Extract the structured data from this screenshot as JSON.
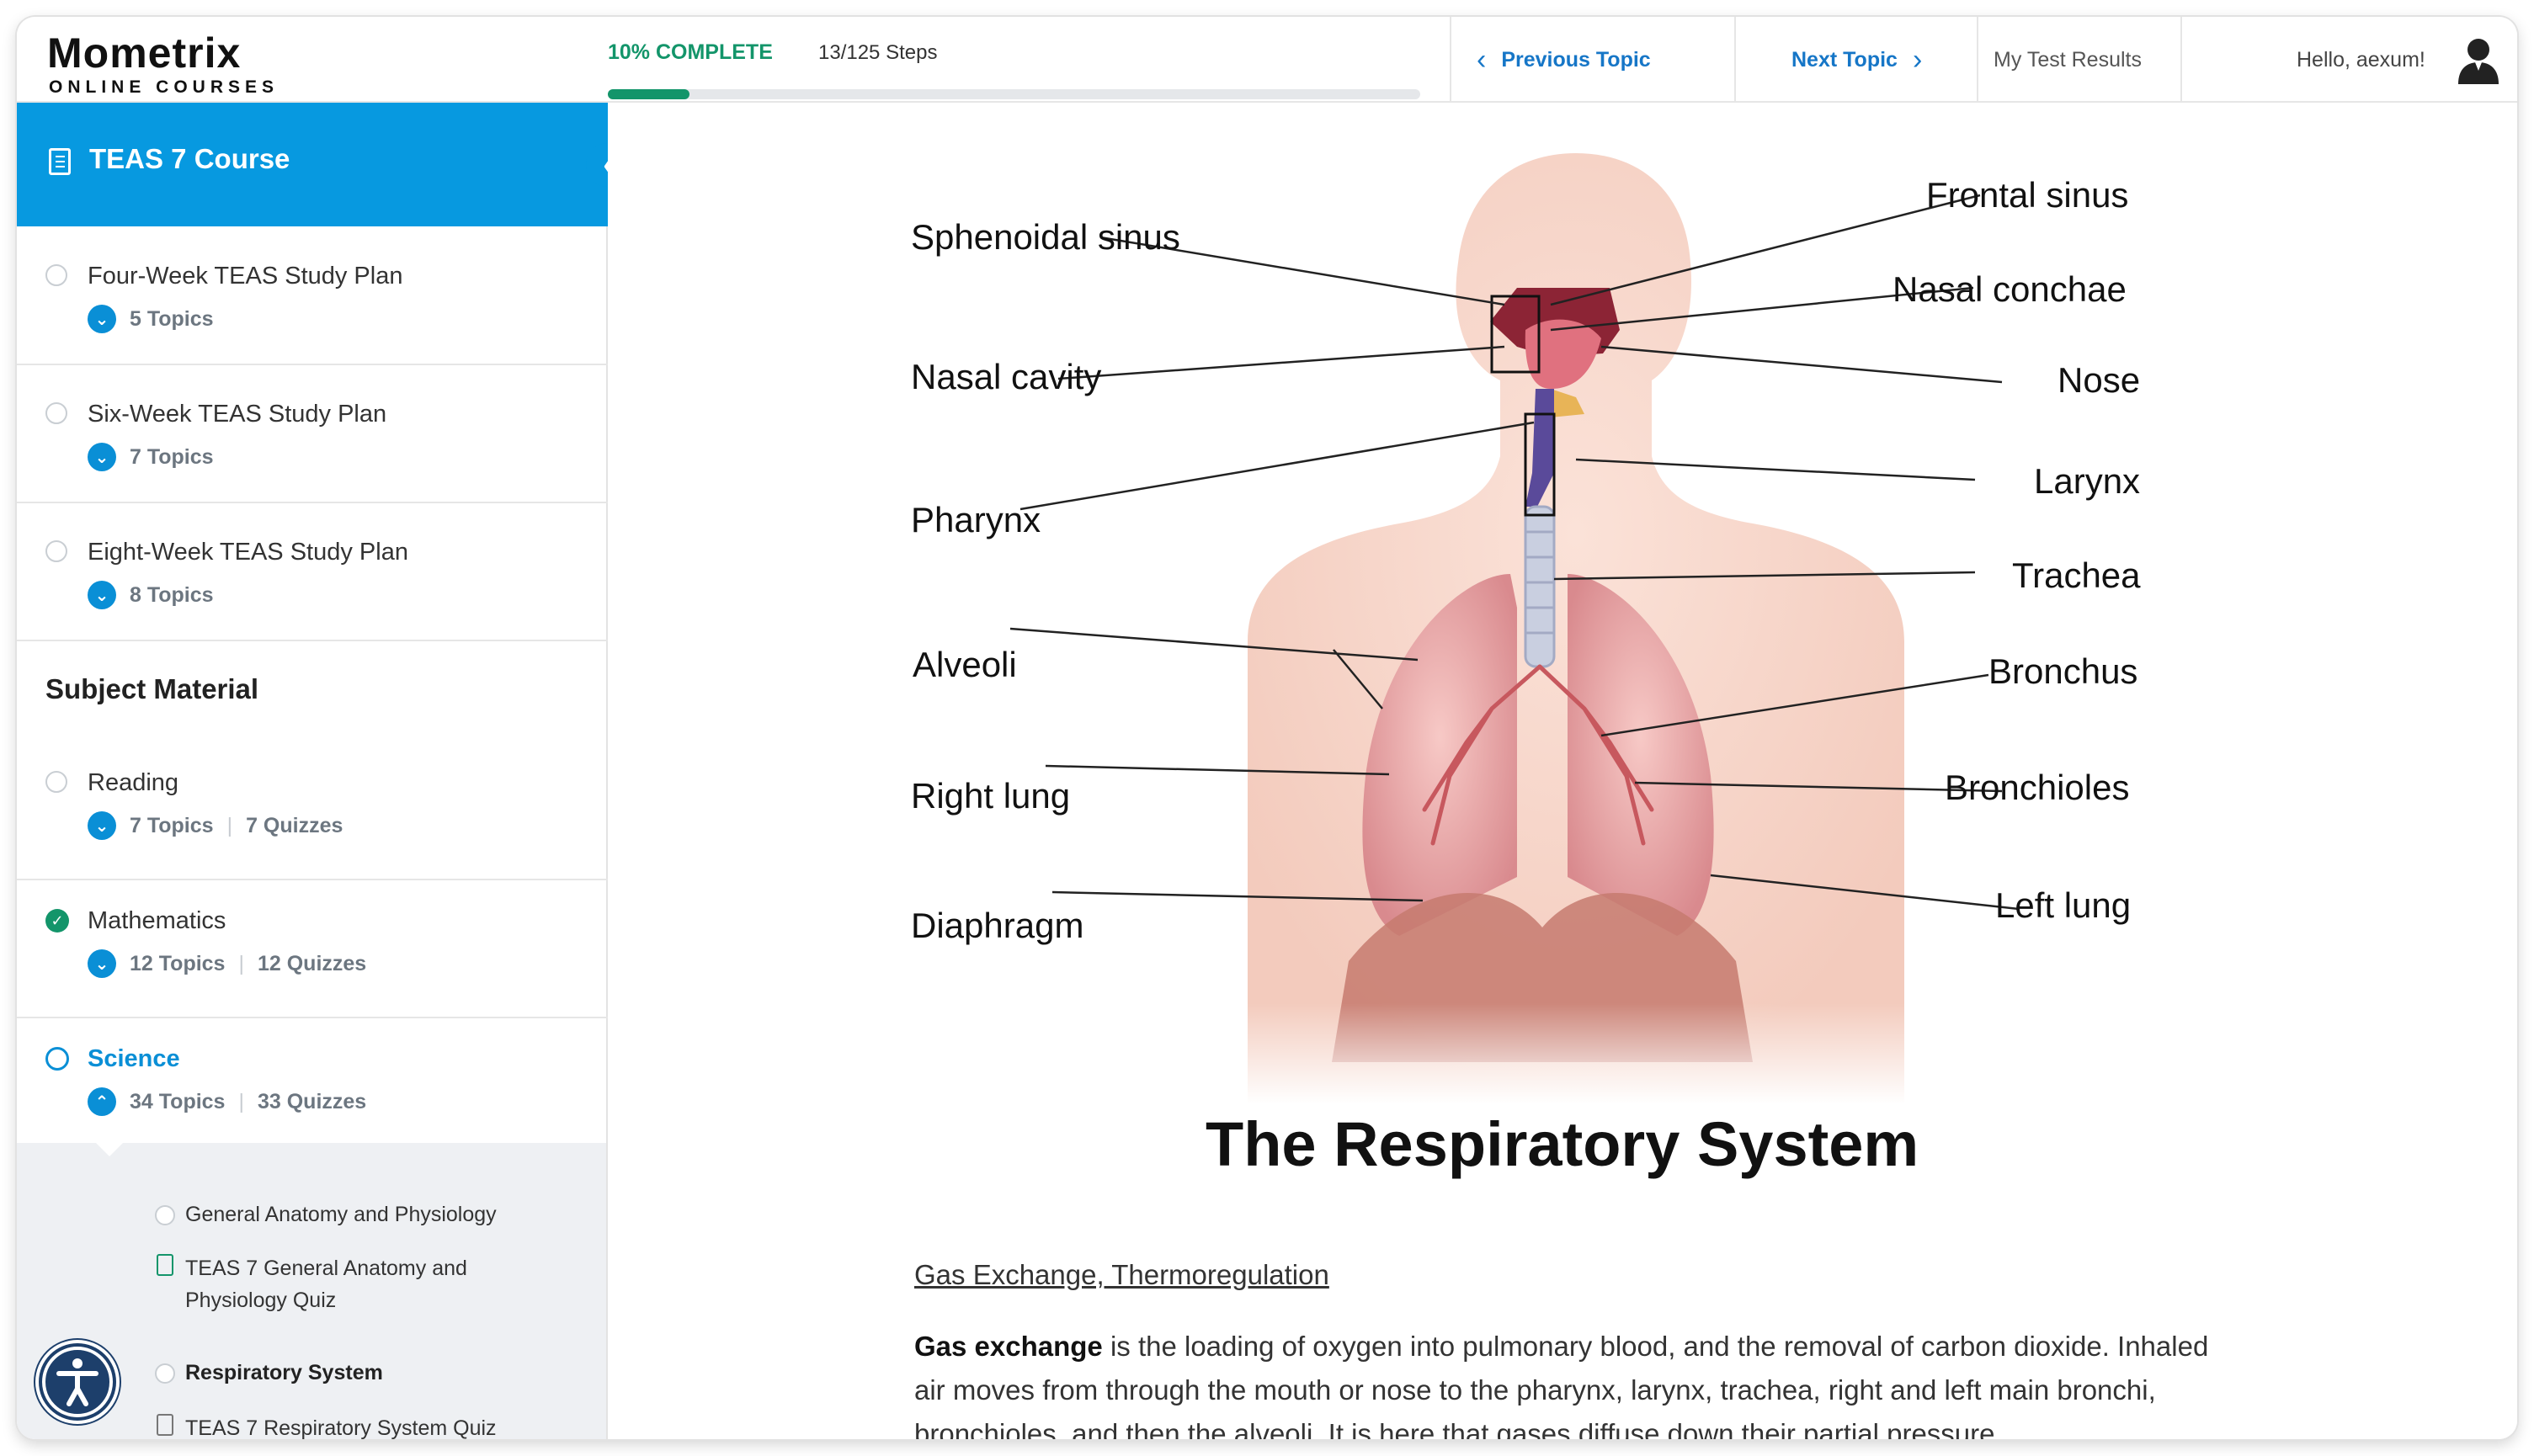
{
  "header": {
    "logo_main": "Mometrix",
    "logo_sub": "ONLINE COURSES",
    "progress_label": "10% COMPLETE",
    "progress_fraction": 0.1,
    "steps_label": "13/125 Steps",
    "prev_label": "Previous Topic",
    "next_label": "Next Topic",
    "results_label": "My Test Results",
    "greeting": "Hello, aexum!"
  },
  "sidebar": {
    "course_title": "TEAS 7 Course",
    "plans": [
      {
        "title": "Four-Week TEAS Study Plan",
        "topics": "5 Topics"
      },
      {
        "title": "Six-Week TEAS Study Plan",
        "topics": "7 Topics"
      },
      {
        "title": "Eight-Week TEAS Study Plan",
        "topics": "8 Topics"
      }
    ],
    "subject_heading": "Subject Material",
    "subjects": [
      {
        "title": "Reading",
        "topics": "7 Topics",
        "quizzes": "7 Quizzes",
        "state": "incomplete"
      },
      {
        "title": "Mathematics",
        "topics": "12 Topics",
        "quizzes": "12 Quizzes",
        "state": "complete"
      },
      {
        "title": "Science",
        "topics": "34 Topics",
        "quizzes": "33 Quizzes",
        "state": "active"
      }
    ],
    "lessons": [
      {
        "label": "General Anatomy and Physiology",
        "kind": "topic"
      },
      {
        "label": "TEAS 7 General Anatomy and",
        "label2": "Physiology Quiz",
        "kind": "quiz"
      },
      {
        "label": "Respiratory System",
        "kind": "topic",
        "current": true
      },
      {
        "label": "TEAS 7 Respiratory System Quiz",
        "kind": "quiz"
      }
    ]
  },
  "figure": {
    "title": "The Respiratory System",
    "left_labels": [
      "Sphenoidal sinus",
      "Nasal cavity",
      "Pharynx",
      "Alveoli",
      "Right lung",
      "Diaphragm"
    ],
    "right_labels": [
      "Frontal sinus",
      "Nasal conchae",
      "Nose",
      "Larynx",
      "Trachea",
      "Bronchus",
      "Bronchioles",
      "Left lung"
    ]
  },
  "content": {
    "topic_link": "Gas Exchange, Thermoregulation",
    "para_bold": "Gas exchange",
    "para_rest": " is the loading of oxygen into pulmonary blood, and the removal of carbon dioxide. Inhaled air moves from through the mouth or nose to the pharynx, larynx, trachea, right and left main bronchi, bronchioles, and then the alveoli. It is here that gases diffuse down their partial pressure"
  },
  "colors": {
    "brand_blue": "#0799e0",
    "link_blue": "#1676c7",
    "complete_green": "#13956a",
    "logo_accent": "#f2a900"
  }
}
